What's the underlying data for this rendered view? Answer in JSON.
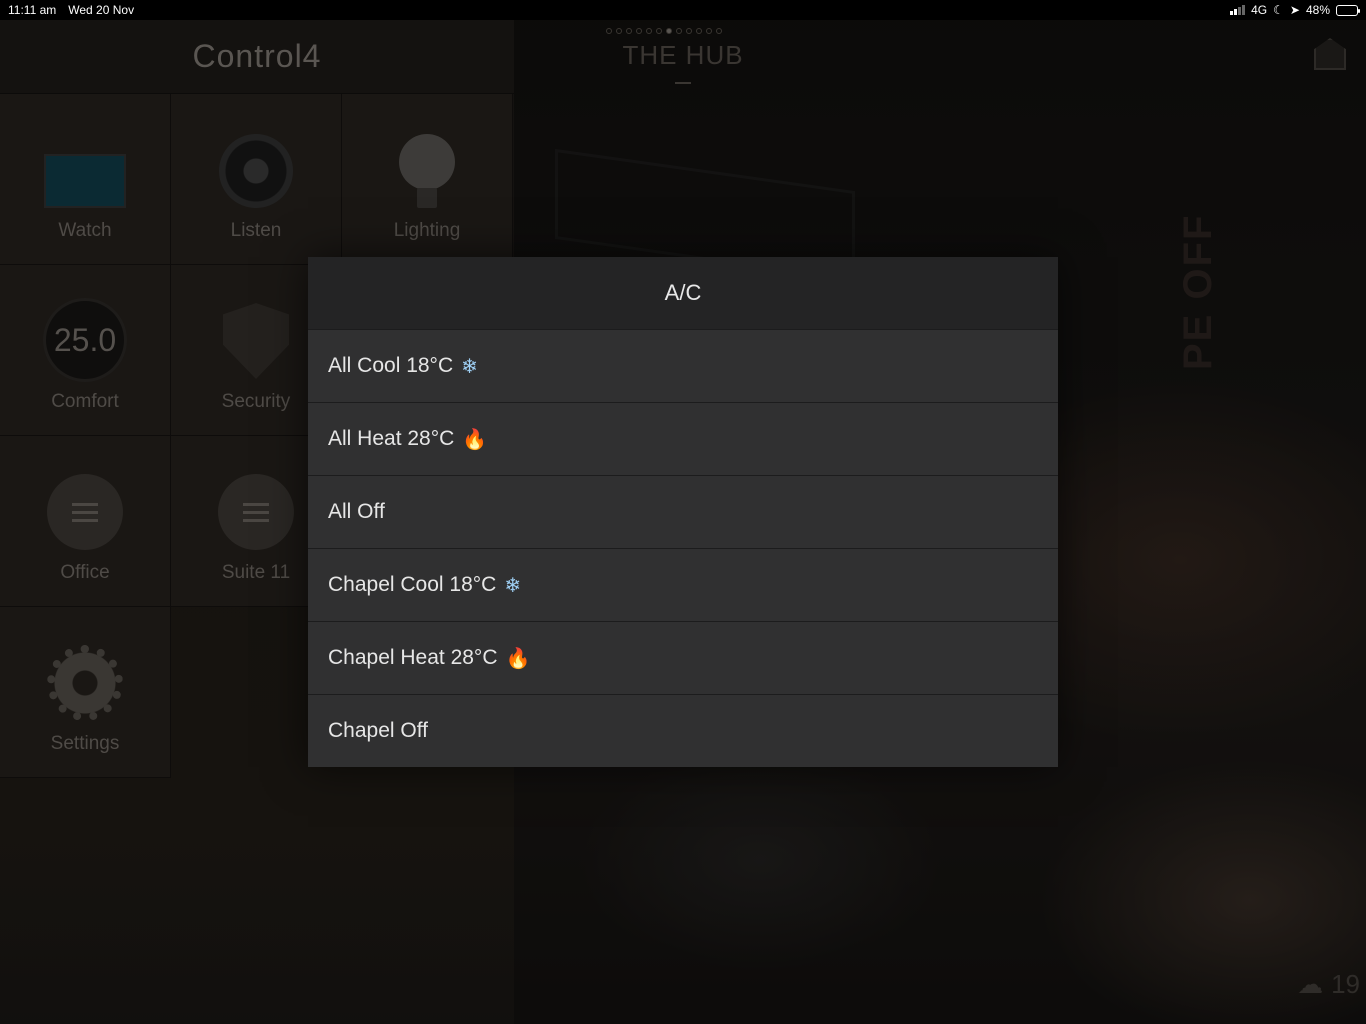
{
  "status_bar": {
    "time": "11:11 am",
    "date": "Wed 20 Nov",
    "network": "4G",
    "battery": "48%",
    "battery_level": 0.48
  },
  "sidebar": {
    "brand": "Control4",
    "tiles": [
      {
        "label": "Watch",
        "icon": "tv-icon"
      },
      {
        "label": "Listen",
        "icon": "speaker-icon"
      },
      {
        "label": "Lighting",
        "icon": "lightbulb-icon"
      },
      {
        "label": "Comfort",
        "icon": "thermostat-icon",
        "value": "25.0"
      },
      {
        "label": "Security",
        "icon": "shield-icon"
      },
      {
        "label": "Office",
        "icon": "menu-icon"
      },
      {
        "label": "Suite 11",
        "icon": "menu-icon"
      },
      {
        "label": "Settings",
        "icon": "gear-icon"
      }
    ]
  },
  "header": {
    "room_title": "THE HUB",
    "page_count": 12,
    "active_page": 7
  },
  "background": {
    "sign_text": "PE OFF"
  },
  "weather": {
    "temp": "19"
  },
  "modal": {
    "title": "A/C",
    "items": [
      {
        "label": "All Cool 18°C",
        "emoji": "❄"
      },
      {
        "label": "All Heat 28°C",
        "emoji": "🔥"
      },
      {
        "label": "All Off",
        "emoji": ""
      },
      {
        "label": "Chapel Cool 18°C",
        "emoji": "❄"
      },
      {
        "label": "Chapel Heat 28°C",
        "emoji": "🔥"
      },
      {
        "label": "Chapel Off",
        "emoji": ""
      }
    ]
  },
  "colors": {
    "modal_bg": "#303031",
    "modal_header": "#242425",
    "snow": "#9fd0f5",
    "fire": "#ff7a1a"
  }
}
